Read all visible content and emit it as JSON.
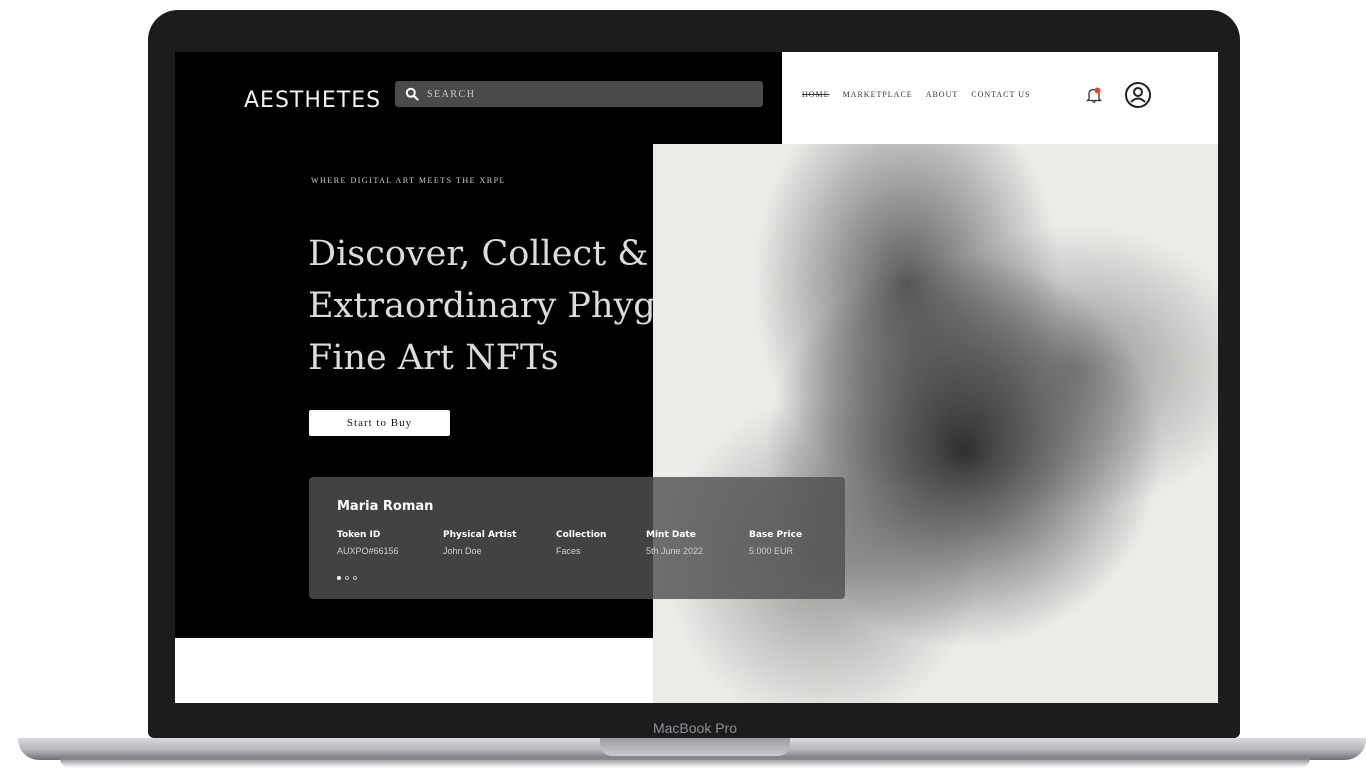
{
  "device": {
    "label": "MacBook Pro"
  },
  "header": {
    "logo": "AESTHETES",
    "search": {
      "placeholder": "SEARCH",
      "icon": "search-icon"
    },
    "nav": [
      {
        "label": "HOME",
        "active": true
      },
      {
        "label": "MARKETPLACE",
        "active": false
      },
      {
        "label": "ABOUT",
        "active": false
      },
      {
        "label": "CONTACT US",
        "active": false
      }
    ],
    "notification_icon": "bell-icon",
    "profile_icon": "user-icon",
    "badge_color": "#e8452c"
  },
  "hero": {
    "kicker": "WHERE DIGITAL ART MEETS THE XRPL",
    "headline_lines": [
      "Discover, Collect & Sell",
      "Extraordinary Phygital",
      "Fine Art NFTs"
    ],
    "cta": "Start to Buy"
  },
  "card": {
    "title": "Maria Roman",
    "fields": [
      {
        "label": "Token ID",
        "value": "AUXPO#66156"
      },
      {
        "label": "Physical Artist",
        "value": "John Doe"
      },
      {
        "label": "Collection",
        "value": "Faces"
      },
      {
        "label": "Mint Date",
        "value": "5th June 2022"
      },
      {
        "label": "Base Price",
        "value": "5.000 EUR"
      }
    ],
    "carousel": {
      "count": 3,
      "active": 0
    }
  }
}
